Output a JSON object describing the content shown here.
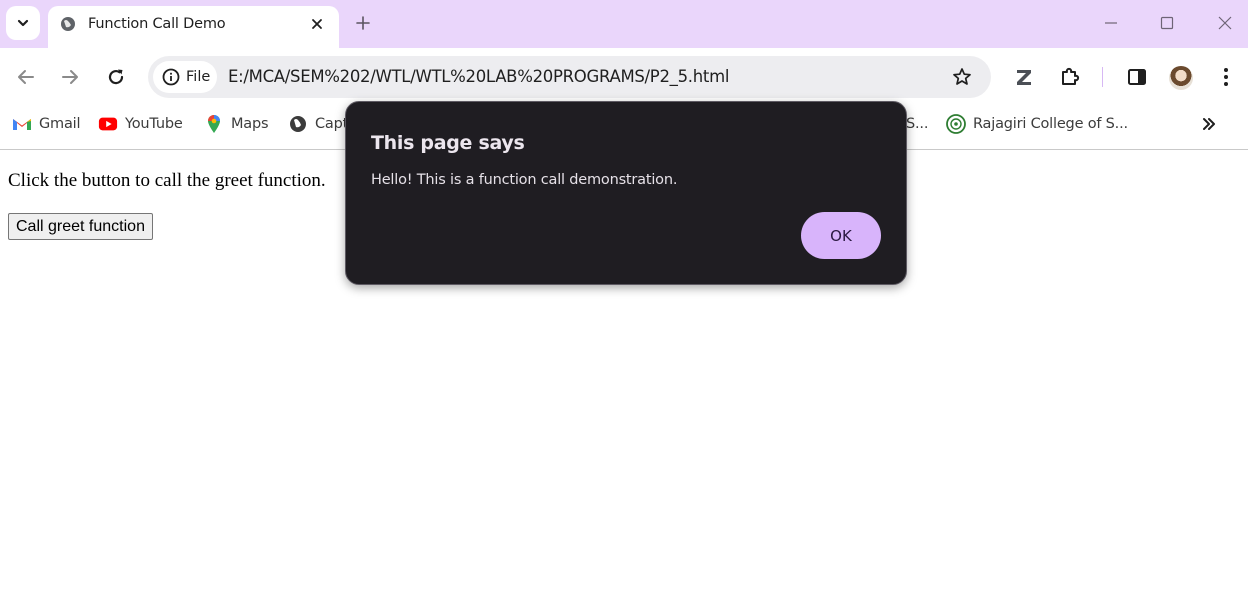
{
  "browser": {
    "tab": {
      "title": "Function Call Demo"
    },
    "address": {
      "chip_label": "File",
      "url": "E:/MCA/SEM%202/WTL/WTL%20LAB%20PROGRAMS/P2_5.html"
    },
    "bookmarks": [
      {
        "label": "Gmail",
        "icon": "gmail-icon"
      },
      {
        "label": "YouTube",
        "icon": "youtube-icon"
      },
      {
        "label": "Maps",
        "icon": "maps-icon"
      },
      {
        "label": "Capt",
        "icon": "globe-icon"
      },
      {
        "label": "S...",
        "icon": ""
      },
      {
        "label": "Rajagiri College of S...",
        "icon": "college-icon"
      }
    ],
    "colors": {
      "tabstrip": "#ead6fb",
      "dialog_bg": "#1f1d22",
      "ok_button": "#d8b4fb"
    }
  },
  "page": {
    "instruction": "Click the button to call the greet function.",
    "button_label": "Call greet function"
  },
  "dialog": {
    "title": "This page says",
    "message": "Hello! This is a function call demonstration.",
    "ok_label": "OK"
  }
}
